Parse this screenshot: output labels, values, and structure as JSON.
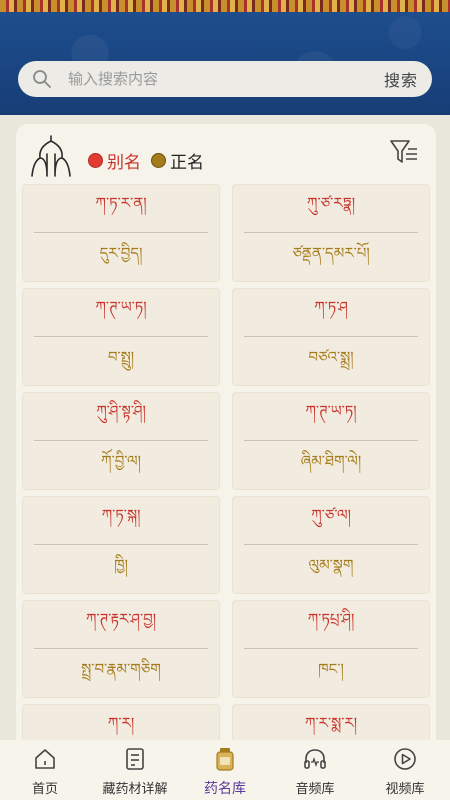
{
  "search": {
    "placeholder": "输入搜索内容",
    "button_label": "搜索"
  },
  "legend": {
    "alias_label": "别名",
    "alias_color": "#e23b32",
    "proper_label": "正名",
    "proper_color": "#a57c1b"
  },
  "cards": [
    {
      "alias": "ཀ་ཏ་ར་ན།",
      "name": "དུར་བྱིད།"
    },
    {
      "alias": "ཀུ་ཙ་རཏྣ།",
      "name": "ཙནྡན་དམར་པོ།"
    },
    {
      "alias": "ཀ་ཊ་ཡ་ཏ།",
      "name": "བ་སྤྲུ།"
    },
    {
      "alias": "ཀ་ཏ་ཤ",
      "name": "བཙའ་སྨྲ།"
    },
    {
      "alias": "ཀུ་ཤི་སྟ་ཤི།",
      "name": "ཀོ་བྱི་ལ།"
    },
    {
      "alias": "ཀ་ཊ་ཡ་ཏ།",
      "name": "ཞིམ་ཐིག་ལེ།"
    },
    {
      "alias": "ཀ་ཏ་སྐ།",
      "name": "ཁྱི།"
    },
    {
      "alias": "ཀུ་ཙ་ལ།",
      "name": "ལུམ་སྣག"
    },
    {
      "alias": "ཀ་ཊ་རྟར་ཤ་བྱ།",
      "name": "སྤྲ་བ་རྣམ་གཅིག"
    },
    {
      "alias": "ཀ་ཏཔྲ་ཤི།",
      "name": "ཁང་།"
    },
    {
      "alias": "ཀ་ར།",
      "name": ""
    },
    {
      "alias": "ཀ་ར་སྨ་ར།",
      "name": ""
    }
  ],
  "tabs": [
    {
      "label": "首页",
      "icon": "home-icon",
      "active": false
    },
    {
      "label": "藏药材详解",
      "icon": "document-icon",
      "active": false
    },
    {
      "label": "药名库",
      "icon": "medicine-jar-icon",
      "active": true
    },
    {
      "label": "音频库",
      "icon": "headphones-icon",
      "active": false
    },
    {
      "label": "视频库",
      "icon": "play-circle-icon",
      "active": false
    }
  ],
  "colors": {
    "banner_blue": "#1e4f8f",
    "alias_text": "#c8332b",
    "name_text": "#a57c1b",
    "active_tab": "#5b3a9a"
  }
}
